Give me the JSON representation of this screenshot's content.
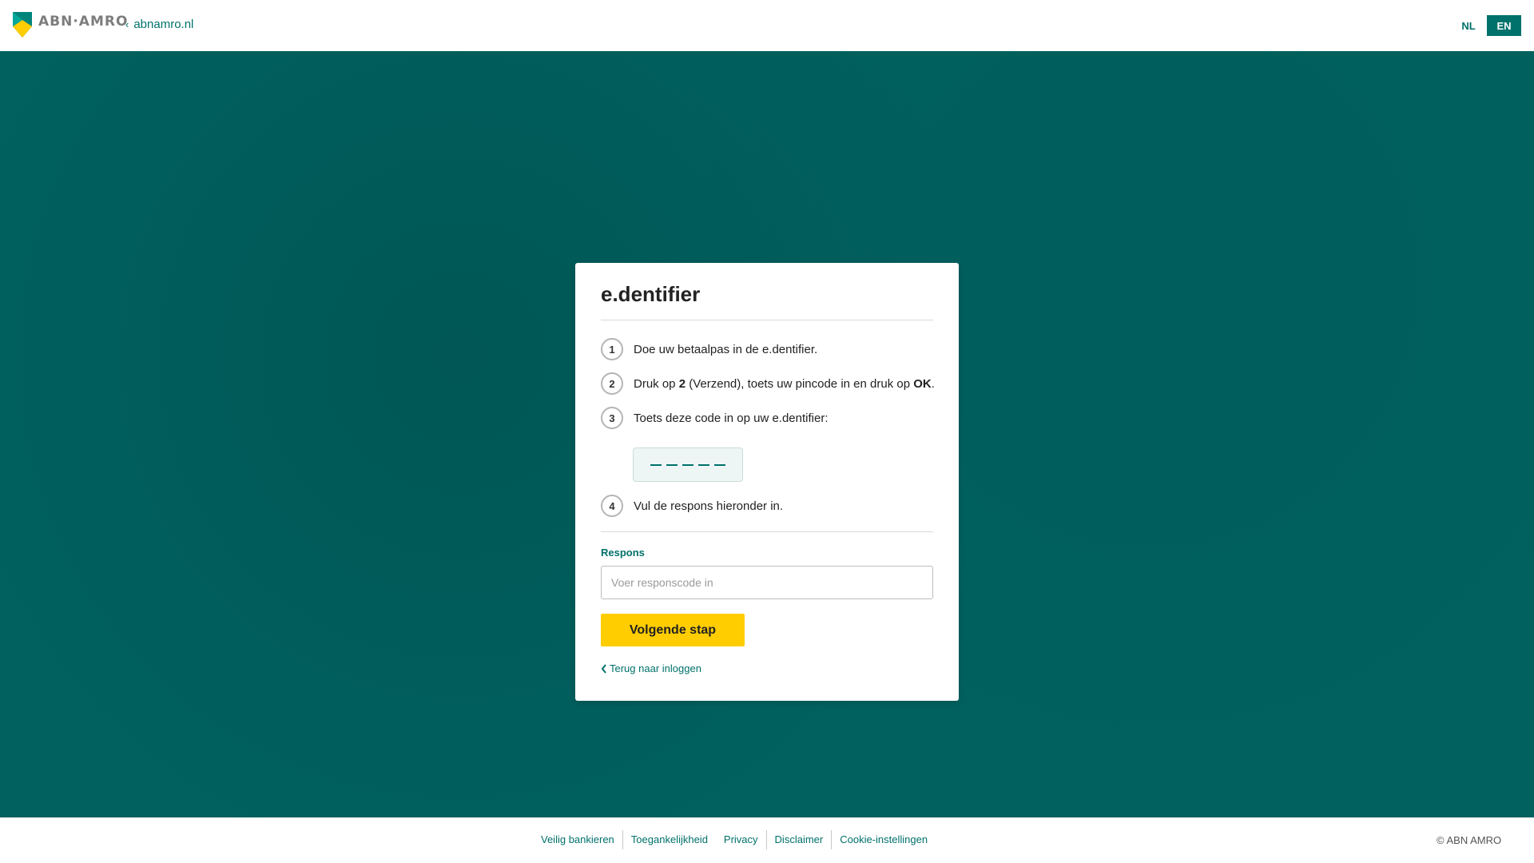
{
  "header": {
    "logo_text": "ABN·AMRO",
    "back_link": "abnamro.nl",
    "languages": [
      "NL",
      "EN"
    ],
    "active_language": "EN"
  },
  "card": {
    "title": "e.dentifier",
    "steps": [
      {
        "num": "1",
        "text": "Doe uw betaalpas in de e.dentifier."
      },
      {
        "num": "2",
        "text_parts": [
          "Druk op ",
          "2",
          " (Verzend), toets uw pincode in en druk op ",
          "OK",
          "."
        ]
      },
      {
        "num": "3",
        "text": "Toets deze code in op uw e.dentifier:"
      },
      {
        "num": "4",
        "text": "Vul de respons hieronder in."
      }
    ],
    "code_placeholder": "—————",
    "response_label": "Respons",
    "response_placeholder": "Voer responscode in",
    "response_value": "",
    "next_button": "Volgende stap",
    "back_to_login": "Terug naar inloggen"
  },
  "footer": {
    "links": [
      "Veilig bankieren",
      "Toegankelijkheid",
      "Privacy",
      "Disclaimer",
      "Cookie-instellingen"
    ],
    "copyright": "© ABN AMRO"
  },
  "colors": {
    "brand_teal": "#00716b",
    "background_teal": "#00615f",
    "button_yellow": "#ffcd00"
  }
}
